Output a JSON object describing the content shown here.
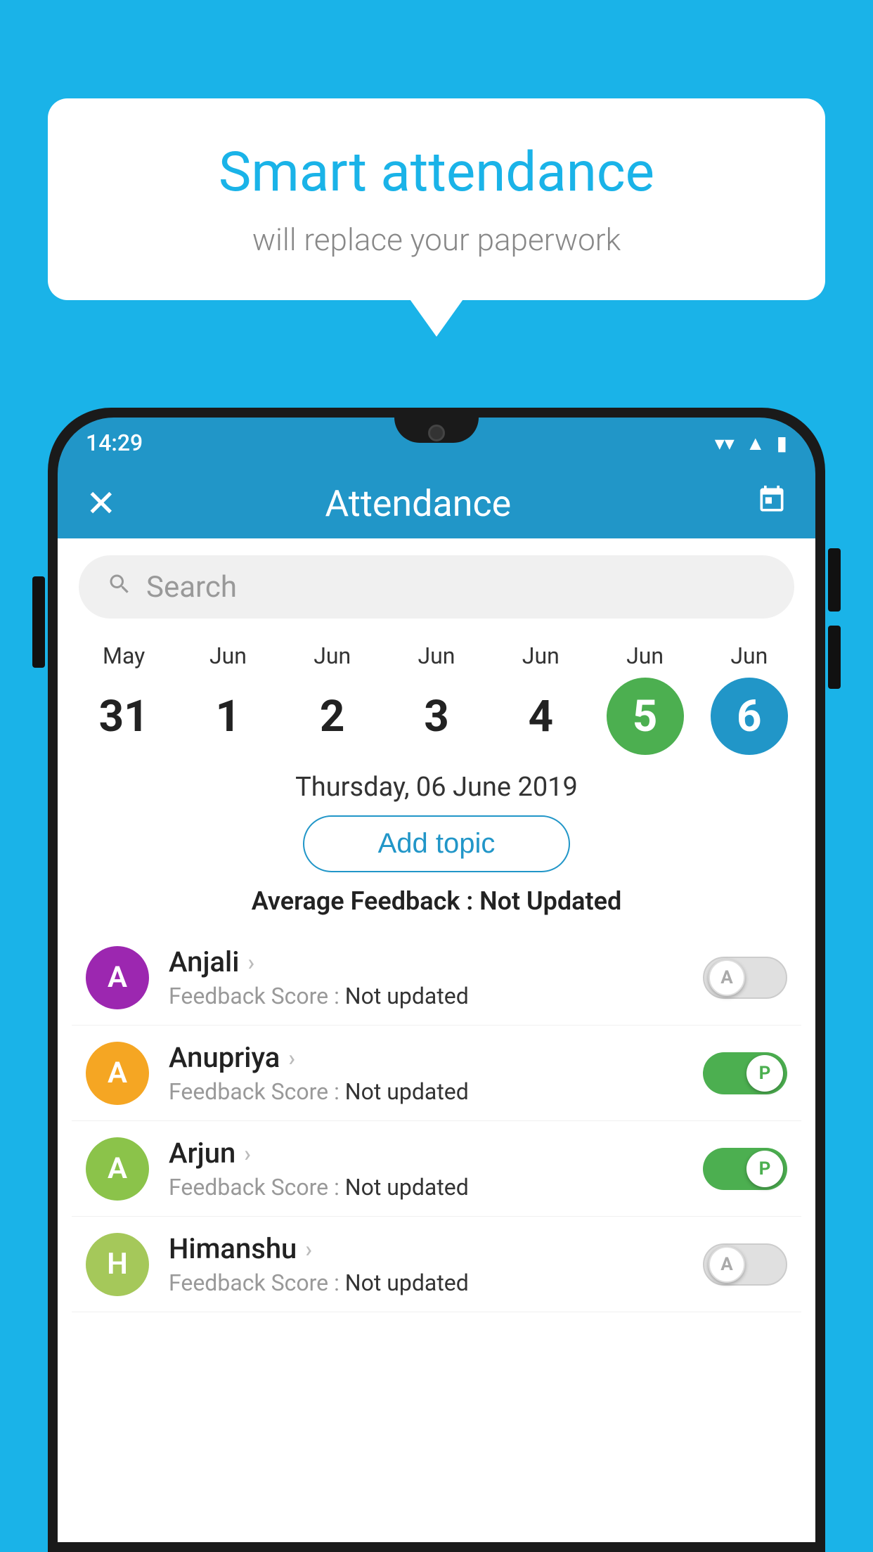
{
  "background_color": "#1ab3e8",
  "speech_bubble": {
    "title": "Smart attendance",
    "subtitle": "will replace your paperwork"
  },
  "status_bar": {
    "time": "14:29",
    "wifi_icon": "▼",
    "signal_icon": "▲",
    "battery_icon": "▮"
  },
  "app_bar": {
    "close_label": "✕",
    "title": "Attendance",
    "calendar_icon": "📅"
  },
  "search": {
    "placeholder": "Search"
  },
  "dates": [
    {
      "month": "May",
      "day": "31",
      "state": "normal"
    },
    {
      "month": "Jun",
      "day": "1",
      "state": "normal"
    },
    {
      "month": "Jun",
      "day": "2",
      "state": "normal"
    },
    {
      "month": "Jun",
      "day": "3",
      "state": "normal"
    },
    {
      "month": "Jun",
      "day": "4",
      "state": "normal"
    },
    {
      "month": "Jun",
      "day": "5",
      "state": "today"
    },
    {
      "month": "Jun",
      "day": "6",
      "state": "selected"
    }
  ],
  "selected_date_label": "Thursday, 06 June 2019",
  "add_topic_label": "Add topic",
  "avg_feedback": {
    "label": "Average Feedback : ",
    "value": "Not Updated"
  },
  "students": [
    {
      "name": "Anjali",
      "avatar_letter": "A",
      "avatar_color": "#9c27b0",
      "feedback_label": "Feedback Score : ",
      "feedback_value": "Not updated",
      "toggle_state": "off",
      "toggle_letter": "A"
    },
    {
      "name": "Anupriya",
      "avatar_letter": "A",
      "avatar_color": "#f5a623",
      "feedback_label": "Feedback Score : ",
      "feedback_value": "Not updated",
      "toggle_state": "on",
      "toggle_letter": "P"
    },
    {
      "name": "Arjun",
      "avatar_letter": "A",
      "avatar_color": "#8bc34a",
      "feedback_label": "Feedback Score : ",
      "feedback_value": "Not updated",
      "toggle_state": "on",
      "toggle_letter": "P"
    },
    {
      "name": "Himanshu",
      "avatar_letter": "H",
      "avatar_color": "#a5c85a",
      "feedback_label": "Feedback Score : ",
      "feedback_value": "Not updated",
      "toggle_state": "off",
      "toggle_letter": "A"
    }
  ]
}
